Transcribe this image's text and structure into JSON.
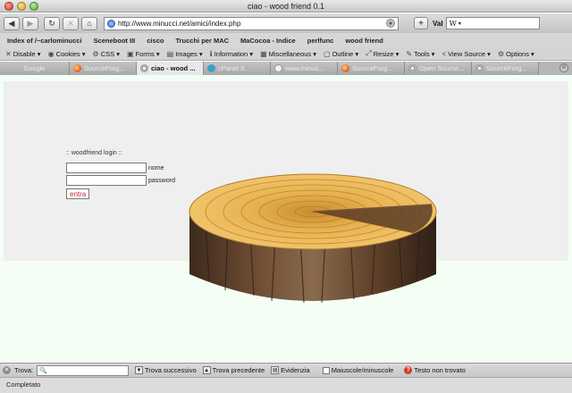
{
  "window": {
    "title": "ciao - wood friend 0.1"
  },
  "nav": {
    "url": "http://www.minucci.net/amici/index.php",
    "search_engine_label": "Val",
    "search_value": "W"
  },
  "bookmarks": [
    "Index of /~carlominucci",
    "Sceneboot III",
    "cisco",
    "Trucchi per MAC",
    "MaCocoa - Indice",
    "perlfunc",
    "wood friend"
  ],
  "devbar": [
    {
      "label": "Disable ▾",
      "icon": "✕"
    },
    {
      "label": "Cookies ▾",
      "icon": "◉"
    },
    {
      "label": "CSS ▾",
      "icon": "⚙"
    },
    {
      "label": "Forms ▾",
      "icon": "▣"
    },
    {
      "label": "Images ▾",
      "icon": "▤"
    },
    {
      "label": "Information ▾",
      "icon": "ℹ"
    },
    {
      "label": "Miscellaneous ▾",
      "icon": "▦"
    },
    {
      "label": "Outline ▾",
      "icon": "▢"
    },
    {
      "label": "Resize ▾",
      "icon": "⤢"
    },
    {
      "label": "Tools ▾",
      "icon": "✎"
    },
    {
      "label": "View Source ▾",
      "icon": "<"
    },
    {
      "label": "Options ▾",
      "icon": "⚙"
    }
  ],
  "tabs": [
    {
      "label": "Google",
      "icon": ""
    },
    {
      "label": "SourceForg...",
      "icon": "ff"
    },
    {
      "label": "ciao - wood ...",
      "icon": "web",
      "active": true
    },
    {
      "label": "cPanel X",
      "icon": "cp"
    },
    {
      "label": "www.minuc...",
      "icon": "w"
    },
    {
      "label": "SourceForg...",
      "icon": "ff"
    },
    {
      "label": "Open Source...",
      "icon": "web"
    },
    {
      "label": "SourceForg...",
      "icon": "web"
    }
  ],
  "login": {
    "title": ":: woodfriend login ::",
    "username_label": "nome",
    "password_label": "password",
    "submit_label": "entra"
  },
  "findbar": {
    "label": "Trova:",
    "value": "",
    "next": "Trova successivo",
    "prev": "Trova precedente",
    "highlight": "Evidenzia",
    "match_case": "Maiuscole/minuscole",
    "status": "Testo non trovato"
  },
  "status": {
    "text": "Completato"
  }
}
